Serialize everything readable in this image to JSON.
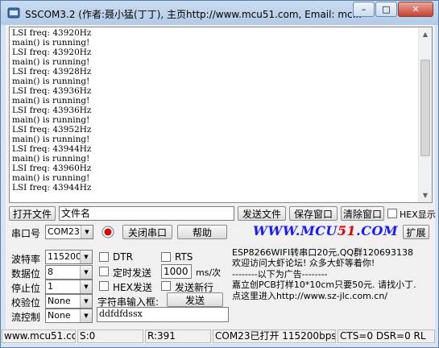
{
  "window": {
    "title": "SSCOM3.2 (作者:聂小猛(丁丁), 主页http://www.mcu51.com,  Email: mc...",
    "minimize": "–",
    "maximize": "□",
    "close": "✕"
  },
  "receive": {
    "text": "LSI freq: 43920Hz\nmain() is running!\nLSI freq: 43920Hz\nmain() is running!\nLSI freq: 43928Hz\nmain() is running!\nLSI freq: 43936Hz\nmain() is running!\nLSI freq: 43936Hz\nmain() is running!\nLSI freq: 43952Hz\nmain() is running!\nLSI freq: 43944Hz\nmain() is running!\nLSI freq: 43960Hz\nmain() is running!\nLSI freq: 43944Hz"
  },
  "file_row": {
    "open_file": "打开文件",
    "filename": "文件名",
    "send_file": "发送文件",
    "save_window": "保存窗口",
    "clear_window": "清除窗口",
    "hex_display": "HEX显示"
  },
  "port_row": {
    "port_label": "串口号",
    "port_value": "COM23",
    "close_port": "关闭串口",
    "help": "帮助",
    "website": "WWW.MCU51.COM",
    "expand": "扩展"
  },
  "settings": {
    "baud_label": "波特率",
    "baud_value": "115200",
    "databits_label": "数据位",
    "databits_value": "8",
    "stopbits_label": "停止位",
    "stopbits_value": "1",
    "parity_label": "校验位",
    "parity_value": "None",
    "flow_label": "流控制",
    "flow_value": "None"
  },
  "send_opts": {
    "dtr": "DTR",
    "rts": "RTS",
    "timed_send": "定时发送",
    "interval": "1000",
    "interval_unit": "ms/次",
    "hex_send": "HEX发送",
    "send_newline": "发送新行",
    "input_label": "字符串输入框:",
    "send_button": "发送",
    "input_value": "ddfdfdssx"
  },
  "ad": {
    "line1": "ESP8266WIFI转串口20元,QQ群120693138",
    "line2": "欢迎访问大虾论坛! 众多大虾等着你!",
    "line3": "--------以下为广告--------",
    "line4": "嘉立创PCB打样10*10cm只要50元. 请找小丁.",
    "line5": "点这里进入http://www.sz-jlc.com.cn/"
  },
  "statusbar": {
    "site": "www.mcu51.cor",
    "sent": "S:0",
    "received": "R:391",
    "port_status": "COM23已打开  115200bps",
    "signals": "CTS=0 DSR=0 RL"
  },
  "colors": {
    "website": "#1a1aff",
    "website_accent": "#e00000"
  }
}
